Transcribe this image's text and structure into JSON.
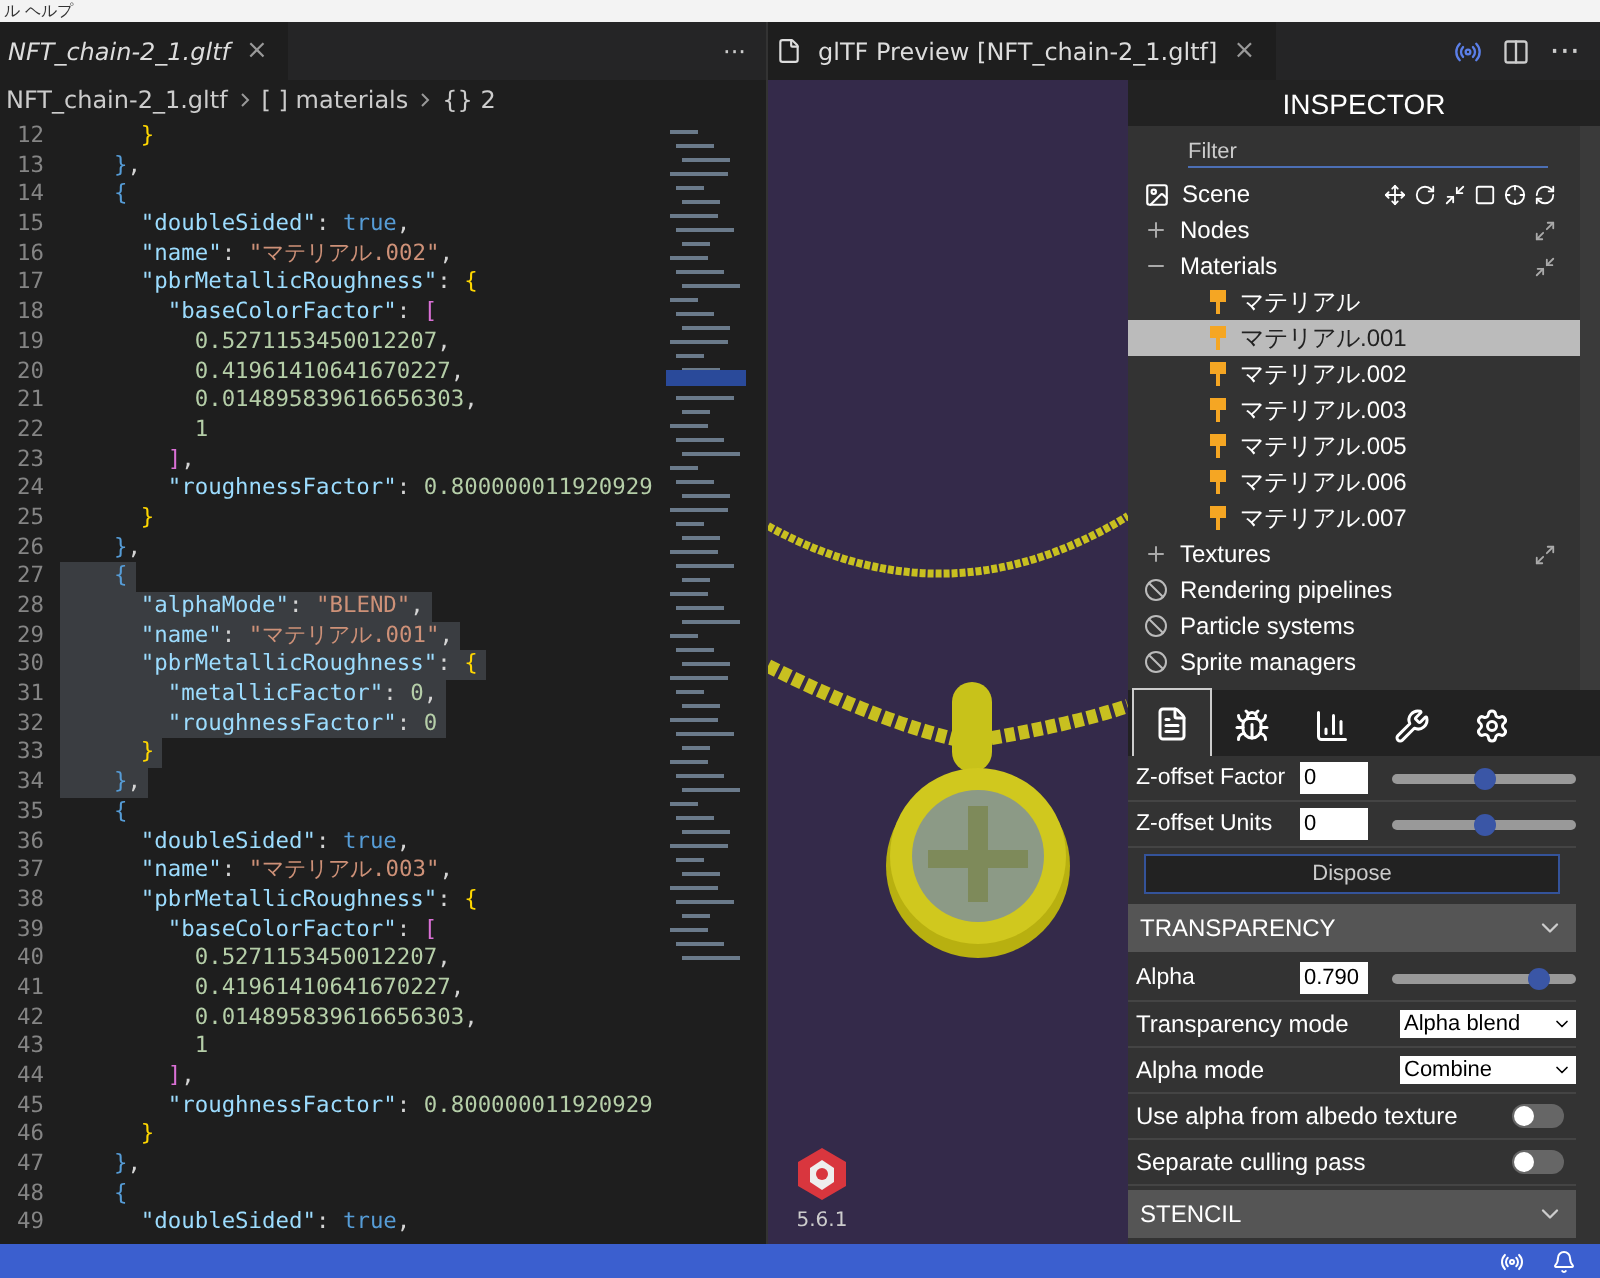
{
  "menu_bar": {
    "text": "ル ヘルプ"
  },
  "editor": {
    "tab": {
      "label": "NFT_chain-2_1.gltf",
      "close": "×",
      "more": "···"
    },
    "breadcrumbs": [
      {
        "label": "NFT_chain-2_1.gltf"
      },
      {
        "label": "[ ] materials"
      },
      {
        "label": "{} 2"
      }
    ],
    "lines": [
      {
        "num": "12",
        "selected": false,
        "tokens": [
          {
            "kind": "b1",
            "text": "      }"
          }
        ]
      },
      {
        "num": "13",
        "selected": false,
        "tokens": [
          {
            "kind": "b2",
            "text": "    }"
          },
          {
            "kind": "punct",
            "text": ","
          }
        ]
      },
      {
        "num": "14",
        "selected": false,
        "tokens": [
          {
            "kind": "b2",
            "text": "    {"
          }
        ]
      },
      {
        "num": "15",
        "selected": false,
        "tokens": [
          {
            "kind": "key",
            "text": "      \"doubleSided\""
          },
          {
            "kind": "punct",
            "text": ": "
          },
          {
            "kind": "kw",
            "text": "true"
          },
          {
            "kind": "punct",
            "text": ","
          }
        ]
      },
      {
        "num": "16",
        "selected": false,
        "tokens": [
          {
            "kind": "key",
            "text": "      \"name\""
          },
          {
            "kind": "punct",
            "text": ": "
          },
          {
            "kind": "str",
            "text": "\"マテリアル.002\""
          },
          {
            "kind": "punct",
            "text": ","
          }
        ]
      },
      {
        "num": "17",
        "selected": false,
        "tokens": [
          {
            "kind": "key",
            "text": "      \"pbrMetallicRoughness\""
          },
          {
            "kind": "punct",
            "text": ": "
          },
          {
            "kind": "b1",
            "text": "{"
          }
        ]
      },
      {
        "num": "18",
        "selected": false,
        "tokens": [
          {
            "kind": "key",
            "text": "        \"baseColorFactor\""
          },
          {
            "kind": "punct",
            "text": ": "
          },
          {
            "kind": "b3",
            "text": "["
          }
        ]
      },
      {
        "num": "19",
        "selected": false,
        "tokens": [
          {
            "kind": "num",
            "text": "          0.5271153450012207"
          },
          {
            "kind": "punct",
            "text": ","
          }
        ]
      },
      {
        "num": "20",
        "selected": false,
        "tokens": [
          {
            "kind": "num",
            "text": "          0.41961410641670227"
          },
          {
            "kind": "punct",
            "text": ","
          }
        ]
      },
      {
        "num": "21",
        "selected": false,
        "tokens": [
          {
            "kind": "num",
            "text": "          0.014895839616656303"
          },
          {
            "kind": "punct",
            "text": ","
          }
        ]
      },
      {
        "num": "22",
        "selected": false,
        "tokens": [
          {
            "kind": "num",
            "text": "          1"
          }
        ]
      },
      {
        "num": "23",
        "selected": false,
        "tokens": [
          {
            "kind": "b3",
            "text": "        ]"
          },
          {
            "kind": "punct",
            "text": ","
          }
        ]
      },
      {
        "num": "24",
        "selected": false,
        "tokens": [
          {
            "kind": "key",
            "text": "        \"roughnessFactor\""
          },
          {
            "kind": "punct",
            "text": ": "
          },
          {
            "kind": "num",
            "text": "0.800000011920929"
          }
        ]
      },
      {
        "num": "25",
        "selected": false,
        "tokens": [
          {
            "kind": "b1",
            "text": "      }"
          }
        ]
      },
      {
        "num": "26",
        "selected": false,
        "tokens": [
          {
            "kind": "b2",
            "text": "    }"
          },
          {
            "kind": "punct",
            "text": ","
          }
        ]
      },
      {
        "num": "27",
        "selected": true,
        "tokens": [
          {
            "kind": "b2",
            "text": "    {"
          }
        ]
      },
      {
        "num": "28",
        "selected": true,
        "tokens": [
          {
            "kind": "key",
            "text": "      \"alphaMode\""
          },
          {
            "kind": "punct",
            "text": ": "
          },
          {
            "kind": "str",
            "text": "\"BLEND\""
          },
          {
            "kind": "punct",
            "text": ","
          }
        ]
      },
      {
        "num": "29",
        "selected": true,
        "tokens": [
          {
            "kind": "key",
            "text": "      \"name\""
          },
          {
            "kind": "punct",
            "text": ": "
          },
          {
            "kind": "str",
            "text": "\"マテリアル.001\""
          },
          {
            "kind": "punct",
            "text": ","
          }
        ]
      },
      {
        "num": "30",
        "selected": true,
        "tokens": [
          {
            "kind": "key",
            "text": "      \"pbrMetallicRoughness\""
          },
          {
            "kind": "punct",
            "text": ": "
          },
          {
            "kind": "b1",
            "text": "{"
          }
        ]
      },
      {
        "num": "31",
        "selected": true,
        "tokens": [
          {
            "kind": "key",
            "text": "        \"metallicFactor\""
          },
          {
            "kind": "punct",
            "text": ": "
          },
          {
            "kind": "num",
            "text": "0"
          },
          {
            "kind": "punct",
            "text": ","
          }
        ]
      },
      {
        "num": "32",
        "selected": true,
        "tokens": [
          {
            "kind": "key",
            "text": "        \"roughnessFactor\""
          },
          {
            "kind": "punct",
            "text": ": "
          },
          {
            "kind": "num",
            "text": "0"
          }
        ]
      },
      {
        "num": "33",
        "selected": true,
        "tokens": [
          {
            "kind": "b1",
            "text": "      }"
          }
        ]
      },
      {
        "num": "34",
        "selected": true,
        "tokens": [
          {
            "kind": "b2",
            "text": "    }"
          },
          {
            "kind": "punct",
            "text": ","
          }
        ]
      },
      {
        "num": "35",
        "selected": false,
        "tokens": [
          {
            "kind": "b2",
            "text": "    {"
          }
        ]
      },
      {
        "num": "36",
        "selected": false,
        "tokens": [
          {
            "kind": "key",
            "text": "      \"doubleSided\""
          },
          {
            "kind": "punct",
            "text": ": "
          },
          {
            "kind": "kw",
            "text": "true"
          },
          {
            "kind": "punct",
            "text": ","
          }
        ]
      },
      {
        "num": "37",
        "selected": false,
        "tokens": [
          {
            "kind": "key",
            "text": "      \"name\""
          },
          {
            "kind": "punct",
            "text": ": "
          },
          {
            "kind": "str",
            "text": "\"マテリアル.003\""
          },
          {
            "kind": "punct",
            "text": ","
          }
        ]
      },
      {
        "num": "38",
        "selected": false,
        "tokens": [
          {
            "kind": "key",
            "text": "      \"pbrMetallicRoughness\""
          },
          {
            "kind": "punct",
            "text": ": "
          },
          {
            "kind": "b1",
            "text": "{"
          }
        ]
      },
      {
        "num": "39",
        "selected": false,
        "tokens": [
          {
            "kind": "key",
            "text": "        \"baseColorFactor\""
          },
          {
            "kind": "punct",
            "text": ": "
          },
          {
            "kind": "b3",
            "text": "["
          }
        ]
      },
      {
        "num": "40",
        "selected": false,
        "tokens": [
          {
            "kind": "num",
            "text": "          0.5271153450012207"
          },
          {
            "kind": "punct",
            "text": ","
          }
        ]
      },
      {
        "num": "41",
        "selected": false,
        "tokens": [
          {
            "kind": "num",
            "text": "          0.41961410641670227"
          },
          {
            "kind": "punct",
            "text": ","
          }
        ]
      },
      {
        "num": "42",
        "selected": false,
        "tokens": [
          {
            "kind": "num",
            "text": "          0.014895839616656303"
          },
          {
            "kind": "punct",
            "text": ","
          }
        ]
      },
      {
        "num": "43",
        "selected": false,
        "tokens": [
          {
            "kind": "num",
            "text": "          1"
          }
        ]
      },
      {
        "num": "44",
        "selected": false,
        "tokens": [
          {
            "kind": "b3",
            "text": "        ]"
          },
          {
            "kind": "punct",
            "text": ","
          }
        ]
      },
      {
        "num": "45",
        "selected": false,
        "tokens": [
          {
            "kind": "key",
            "text": "        \"roughnessFactor\""
          },
          {
            "kind": "punct",
            "text": ": "
          },
          {
            "kind": "num",
            "text": "0.800000011920929"
          }
        ]
      },
      {
        "num": "46",
        "selected": false,
        "tokens": [
          {
            "kind": "b1",
            "text": "      }"
          }
        ]
      },
      {
        "num": "47",
        "selected": false,
        "tokens": [
          {
            "kind": "b2",
            "text": "    }"
          },
          {
            "kind": "punct",
            "text": ","
          }
        ]
      },
      {
        "num": "48",
        "selected": false,
        "tokens": [
          {
            "kind": "b2",
            "text": "    {"
          }
        ]
      },
      {
        "num": "49",
        "selected": false,
        "tokens": [
          {
            "kind": "key",
            "text": "      \"doubleSided\""
          },
          {
            "kind": "punct",
            "text": ": "
          },
          {
            "kind": "kw",
            "text": "true"
          },
          {
            "kind": "punct",
            "text": ","
          }
        ]
      }
    ]
  },
  "preview": {
    "tab": {
      "label": "glTF Preview [NFT_chain-2_1.gltf]",
      "close": "×",
      "more": "···"
    },
    "version": "5.6.1"
  },
  "inspector": {
    "title": "INSPECTOR",
    "filter": {
      "placeholder": "Filter"
    },
    "scene": {
      "label": "Scene"
    },
    "tree": [
      {
        "kind": "group",
        "label": "Nodes",
        "expanded": false
      },
      {
        "kind": "group",
        "label": "Materials",
        "expanded": true,
        "children": [
          {
            "label": "マテリアル",
            "selected": false
          },
          {
            "label": "マテリアル.001",
            "selected": true
          },
          {
            "label": "マテリアル.002",
            "selected": false
          },
          {
            "label": "マテリアル.003",
            "selected": false
          },
          {
            "label": "マテリアル.005",
            "selected": false
          },
          {
            "label": "マテリアル.006",
            "selected": false
          },
          {
            "label": "マテリアル.007",
            "selected": false
          }
        ]
      },
      {
        "kind": "group",
        "label": "Textures",
        "expanded": false
      },
      {
        "kind": "disabled",
        "label": "Rendering pipelines"
      },
      {
        "kind": "disabled",
        "label": "Particle systems"
      },
      {
        "kind": "disabled",
        "label": "Sprite managers"
      }
    ],
    "tabs": [
      {
        "selected": true
      },
      {
        "selected": false
      },
      {
        "selected": false
      },
      {
        "selected": false
      },
      {
        "selected": false
      }
    ],
    "properties": [
      {
        "kind": "slider",
        "label": "Z-offset Factor",
        "value": "0",
        "level": 0.5
      },
      {
        "kind": "slider",
        "label": "Z-offset Units",
        "value": "0",
        "level": 0.5
      },
      {
        "kind": "button",
        "label": "Dispose"
      },
      {
        "kind": "header",
        "label": "TRANSPARENCY"
      },
      {
        "kind": "slider",
        "label": "Alpha",
        "value": "0.790",
        "level": 0.79
      },
      {
        "kind": "select",
        "label": "Transparency mode",
        "value": "Alpha blend"
      },
      {
        "kind": "select",
        "label": "Alpha mode",
        "value": "Combine"
      },
      {
        "kind": "toggle",
        "label": "Use alpha from albedo texture",
        "on": false
      },
      {
        "kind": "toggle",
        "label": "Separate culling pass",
        "on": false
      },
      {
        "kind": "header",
        "label": "STENCIL"
      }
    ]
  }
}
